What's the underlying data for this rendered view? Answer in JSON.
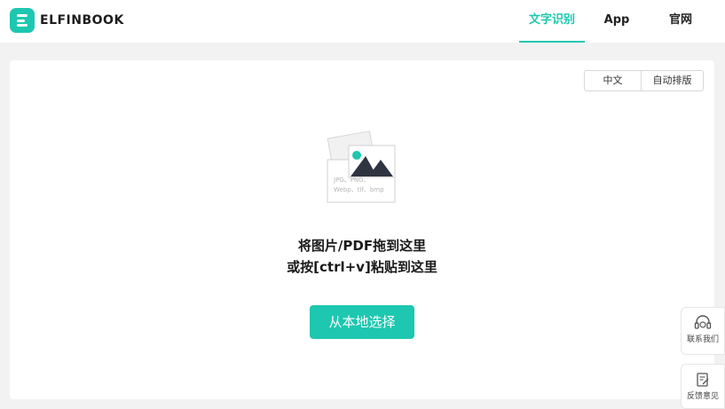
{
  "brand": {
    "name": "ELFINBOOK",
    "accent": "#1ec7b0"
  },
  "nav": {
    "items": [
      {
        "label": "文字识别",
        "active": true
      },
      {
        "label": "App",
        "active": false
      },
      {
        "label": "官网",
        "active": false
      }
    ]
  },
  "options": {
    "language": "中文",
    "layout": "自动排版"
  },
  "upload": {
    "formats_line1": "JPG、PNG、",
    "formats_line2": "Webp、tif、bmp",
    "instruction_line1": "将图片/PDF拖到这里",
    "instruction_line2": "或按[ctrl+v]粘贴到这里",
    "button": "从本地选择"
  },
  "side": {
    "contact": {
      "label": "联系我们",
      "icon": "headset-icon"
    },
    "feedback": {
      "label": "反馈意见",
      "icon": "edit-note-icon"
    }
  }
}
